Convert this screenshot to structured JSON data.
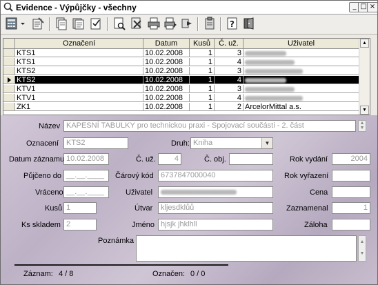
{
  "window": {
    "title": "Evidence - Výpůjčky - všechny",
    "controls": [
      "minimize",
      "maximize",
      "close"
    ]
  },
  "toolbar": {
    "icons": [
      "calculator-icon",
      "dropdown-arrow-icon",
      "edit-form-icon",
      "copy-doc-icon",
      "multi-doc-icon",
      "check-doc-icon",
      "find-doc-icon",
      "delete-doc-icon",
      "print-icon",
      "print-preview-icon",
      "forward-icon",
      "clipboard-icon",
      "help-icon",
      "exit-icon"
    ]
  },
  "grid": {
    "columns": [
      "Označení",
      "Datum",
      "Kusů",
      "Č. už.",
      "Uživatel"
    ],
    "rows": [
      {
        "oznaceni": "KTS1",
        "datum": "10.02.2008",
        "kusu": "1",
        "c_uz": "3",
        "uzivatel": ""
      },
      {
        "oznaceni": "KTS1",
        "datum": "10.02.2008",
        "kusu": "1",
        "c_uz": "4",
        "uzivatel": ""
      },
      {
        "oznaceni": "KTS2",
        "datum": "10.02.2008",
        "kusu": "1",
        "c_uz": "3",
        "uzivatel": ""
      },
      {
        "oznaceni": "KTS2",
        "datum": "10.02.2008",
        "kusu": "1",
        "c_uz": "4",
        "uzivatel": ""
      },
      {
        "oznaceni": "KTV1",
        "datum": "10.02.2008",
        "kusu": "1",
        "c_uz": "3",
        "uzivatel": ""
      },
      {
        "oznaceni": "KTV1",
        "datum": "10.02.2008",
        "kusu": "1",
        "c_uz": "4",
        "uzivatel": ""
      },
      {
        "oznaceni": "ZK1",
        "datum": "10.02.2008",
        "kusu": "1",
        "c_uz": "2",
        "uzivatel": "ArcelorMittal a.s."
      }
    ],
    "selected_row": 3
  },
  "form": {
    "nazev_label": "Název",
    "nazev_value": "KAPESNÍ TABULKY pro technickou praxi - Spojovací součásti - 2. část",
    "oznaceni_label": "Oznacení",
    "oznaceni_value": "KTS2",
    "druh_label": "Druh:",
    "druh_value": "Kniha",
    "datum_zaznamu_label": "Datum záznamu",
    "datum_zaznamu_value": "10.02.2008",
    "c_uz_label": "Č. už.",
    "c_uz_value": "4",
    "c_obj_label": "Č. obj.",
    "c_obj_value": "",
    "rok_vydani_label": "Rok vydání",
    "rok_vydani_value": "2004",
    "pujceno_do_label": "Půjčeno do",
    "pujceno_do_value": "__.__.____",
    "carovy_kod_label": "Čárový kód",
    "carovy_kod_value": "6737847000040",
    "rok_vyrazeni_label": "Rok vyřazení",
    "rok_vyrazeni_value": "",
    "vraceno_label": "Vráceno",
    "vraceno_value": "__.__.____",
    "uzivatel_label": "Uživatel",
    "uzivatel_value": "",
    "cena_label": "Cena",
    "cena_value": "",
    "kusu_label": "Kusů",
    "kusu_value": "1",
    "utvar_label": "Útvar",
    "utvar_value": "kljesdklůů",
    "zaznamenal_label": "Zaznamenal",
    "zaznamenal_value": "1",
    "ks_skladem_label": "Ks skladem",
    "ks_skladem_value": "2",
    "jmeno_label": "Jméno",
    "jmeno_value": "hjsjk jhklhll",
    "zaloha_label": "Záloha",
    "zaloha_value": "",
    "poznamka_label": "Poznámka",
    "poznamka_value": ""
  },
  "status": {
    "zaznam_label": "Záznam:",
    "zaznam_value": "4 / 8",
    "oznacen_label": "Označen:",
    "oznacen_value": "0 / 0"
  },
  "colors": {
    "selected_row_bg": "#000000",
    "form_bg": "#c4b9cc",
    "disabled_text": "#9a9a9a"
  }
}
